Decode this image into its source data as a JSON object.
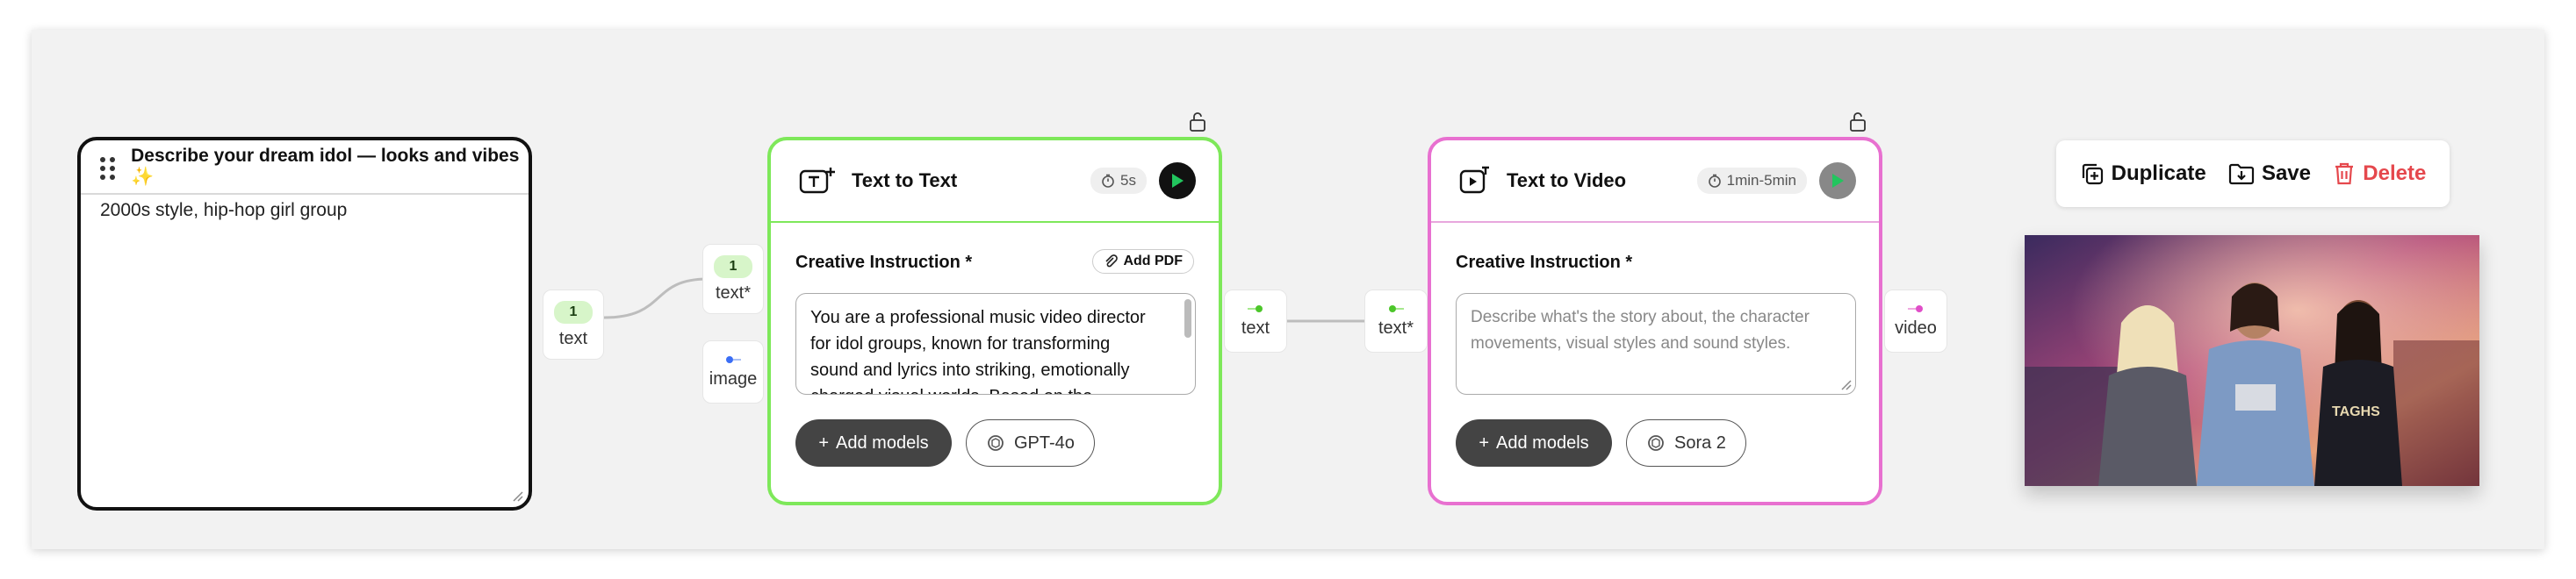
{
  "idol_card": {
    "title": "Describe your dream idol — looks and vibes",
    "sparkle": "✨",
    "text": "2000s style, hip-hop girl group"
  },
  "ports": {
    "idol_out": {
      "count": "1",
      "label": "text"
    },
    "tt_in_text": {
      "count": "1",
      "label": "text*"
    },
    "tt_in_image": {
      "label": "image"
    },
    "tt_out": {
      "label": "text"
    },
    "tv_in": {
      "label": "text*"
    },
    "tv_out": {
      "label": "video"
    }
  },
  "text_to_text": {
    "title": "Text to Text",
    "time": "5s",
    "field_label": "Creative Instruction *",
    "add_pdf": "Add PDF",
    "prompt_lines": [
      "You are a professional music video director",
      "for idol groups, known for transforming",
      "sound and lyrics into striking, emotionally",
      "charged visual worlds. Based on the"
    ],
    "add_models": "Add models",
    "model": "GPT-4o",
    "accent": "#7ee85a"
  },
  "text_to_video": {
    "title": "Text to Video",
    "time": "1min-5min",
    "field_label": "Creative Instruction *",
    "placeholder_lines": [
      "Describe what's the story about, the character",
      "movements, visual styles and sound styles."
    ],
    "add_models": "Add models",
    "model": "Sora 2",
    "accent": "#e870d0"
  },
  "toolbar": {
    "duplicate": "Duplicate",
    "save": "Save",
    "delete": "Delete",
    "delete_color": "#e5484d"
  },
  "colors": {
    "canvas": "#f2f2f2",
    "play_active": "#22c55e"
  }
}
